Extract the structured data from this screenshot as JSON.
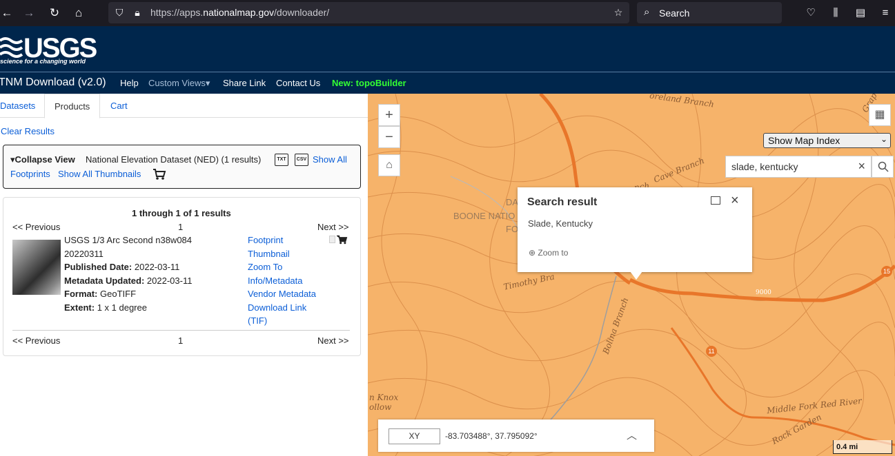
{
  "browser": {
    "url_prefix": "https://apps.",
    "url_domain": "nationalmap.gov",
    "url_path": "/downloader/",
    "search_label": "Search"
  },
  "header": {
    "logo_word": "USGS",
    "logo_tagline": "science for a changing world"
  },
  "appnav": {
    "title": "TNM Download (v2.0)",
    "items": [
      "Help",
      "Custom Views▾",
      "Share Link",
      "Contact Us"
    ],
    "highlight": "New: topoBuilder",
    "highlight_color": "#33ff33"
  },
  "tabs": [
    "Datasets",
    "Products",
    "Cart"
  ],
  "active_tab": "Products",
  "clear_results": "Clear Results",
  "collapse": {
    "toggle": "▾Collapse View",
    "dataset": "National Elevation Dataset (NED) (1 results)",
    "txt_icon": "TXT",
    "csv_icon": "CSV",
    "show_all": "Show All",
    "footprints": "Footprints",
    "show_all_thumbnails": "Show All Thumbnails"
  },
  "results": {
    "summary": "1 through 1 of 1 results",
    "prev": "<< Previous",
    "page": "1",
    "next": "Next >>",
    "item": {
      "title_line1": "USGS 1/3 Arc Second n38w084",
      "title_line2": "20220311",
      "published_label": "Published Date:",
      "published": "2022-03-11",
      "metadata_label": "Metadata Updated:",
      "metadata": "2022-03-11",
      "format_label": "Format:",
      "format": "GeoTIFF",
      "extent_label": "Extent:",
      "extent": "1 x 1 degree",
      "links": [
        "Footprint",
        "Thumbnail",
        "Zoom To",
        "Info/Metadata",
        "Vendor Metadata",
        "Download Link",
        "(TIF)"
      ]
    }
  },
  "map": {
    "zoom_in": "+",
    "zoom_out": "−",
    "map_index": "Show Map Index",
    "search_value": "slade, kentucky",
    "popup_title": "Search result",
    "popup_text": "Slade, Kentucky",
    "popup_zoom": "Zoom to",
    "xy_label": "XY",
    "coordinates": "-83.703488°, 37.795092°",
    "scale": "0.4 mi",
    "labels": [
      "oreland Branch",
      "Grap",
      "Cave Branch",
      "nch",
      "DA",
      "BOONE NATIO",
      "FO",
      "Timothy Bra",
      "Bolina Branch",
      "Middle Fork Red River",
      "Rock Garden",
      "n Knox",
      "ollow",
      "9000",
      "11",
      "15"
    ],
    "colors": {
      "land": "#f6b36a",
      "road": "#e8762a",
      "contour": "#d98c48"
    }
  }
}
